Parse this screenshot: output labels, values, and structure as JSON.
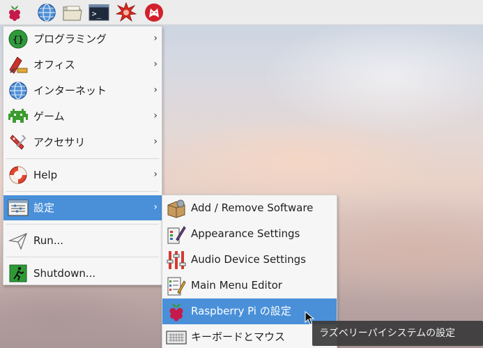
{
  "panel": {
    "launchers": [
      {
        "icon": "raspberry-menu-icon"
      },
      {
        "icon": "web-browser-icon"
      },
      {
        "icon": "file-manager-icon"
      },
      {
        "icon": "terminal-icon"
      },
      {
        "icon": "mathematica-icon"
      },
      {
        "icon": "wolfram-icon"
      }
    ],
    "terminal_glyph": ">_"
  },
  "menu": {
    "items": [
      {
        "label": "プログラミング",
        "icon": "programming-icon",
        "has_submenu": true
      },
      {
        "label": "オフィス",
        "icon": "office-icon",
        "has_submenu": true
      },
      {
        "label": "インターネット",
        "icon": "internet-icon",
        "has_submenu": true
      },
      {
        "label": "ゲーム",
        "icon": "games-icon",
        "has_submenu": true
      },
      {
        "label": "アクセサリ",
        "icon": "accessories-icon",
        "has_submenu": true
      },
      {
        "label": "Help",
        "icon": "help-icon",
        "has_submenu": true
      },
      {
        "label": "設定",
        "icon": "preferences-icon",
        "has_submenu": true,
        "selected": true
      },
      {
        "label": "Run...",
        "icon": "run-icon",
        "has_submenu": false
      },
      {
        "label": "Shutdown...",
        "icon": "shutdown-icon",
        "has_submenu": false
      }
    ],
    "arrow": "›",
    "programming_glyph": "{}"
  },
  "submenu": {
    "items": [
      {
        "label": "Add / Remove Software",
        "icon": "add-remove-software-icon"
      },
      {
        "label": "Appearance Settings",
        "icon": "appearance-settings-icon"
      },
      {
        "label": "Audio Device Settings",
        "icon": "audio-device-settings-icon"
      },
      {
        "label": "Main Menu Editor",
        "icon": "main-menu-editor-icon"
      },
      {
        "label": "Raspberry Pi の設定",
        "icon": "raspberry-pi-config-icon",
        "selected": true
      },
      {
        "label": "キーボードとマウス",
        "icon": "keyboard-mouse-icon"
      }
    ]
  },
  "tooltip": {
    "text": "ラズベリーパイシステムの設定"
  },
  "colors": {
    "selection": "#4a90d9",
    "menu_bg": "#f6f6f6",
    "panel_bg": "#ececec"
  }
}
